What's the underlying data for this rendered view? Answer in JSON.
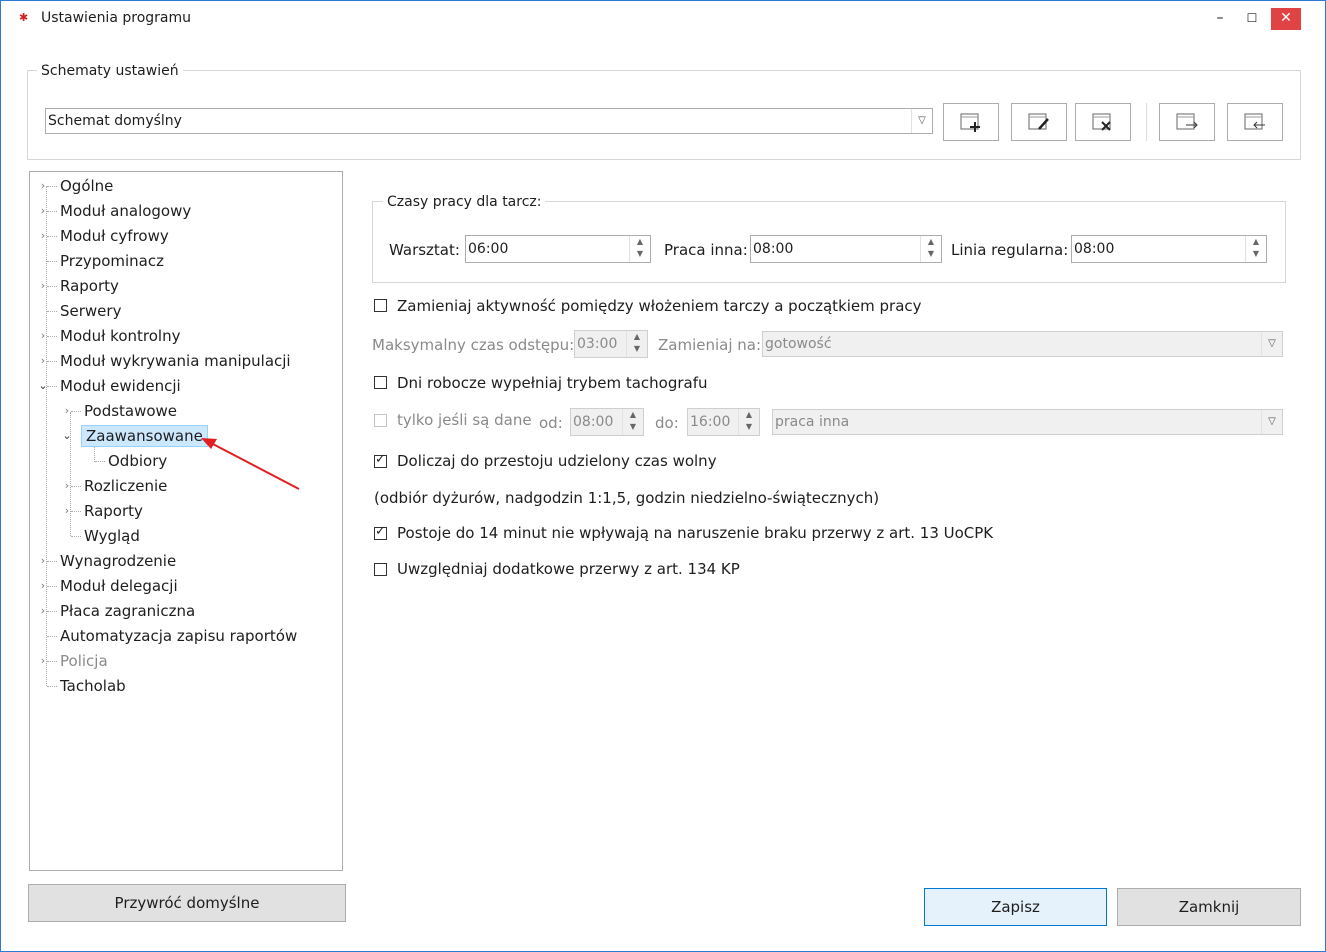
{
  "window": {
    "title": "Ustawienia programu",
    "minimize": "–",
    "maximize": "☐",
    "close": "✕"
  },
  "schemes": {
    "legend": "Schematy ustawień",
    "selected": "Schemat domyślny",
    "toolbar_icons": [
      "add-scheme-icon",
      "edit-scheme-icon",
      "delete-scheme-icon",
      "export-scheme-icon",
      "import-scheme-icon"
    ]
  },
  "tree": {
    "items": [
      {
        "label": "Ogólne"
      },
      {
        "label": "Moduł analogowy"
      },
      {
        "label": "Moduł cyfrowy"
      },
      {
        "label": "Przypominacz"
      },
      {
        "label": "Raporty"
      },
      {
        "label": "Serwery"
      },
      {
        "label": "Moduł kontrolny"
      },
      {
        "label": "Moduł wykrywania manipulacji"
      },
      {
        "label": "Moduł ewidencji"
      },
      {
        "label": "Podstawowe"
      },
      {
        "label": "Zaawansowane"
      },
      {
        "label": "Odbiory"
      },
      {
        "label": "Rozliczenie"
      },
      {
        "label": "Raporty"
      },
      {
        "label": "Wygląd"
      },
      {
        "label": "Wynagrodzenie"
      },
      {
        "label": "Moduł delegacji"
      },
      {
        "label": "Płaca zagraniczna"
      },
      {
        "label": "Automatyzacja zapisu raportów"
      },
      {
        "label": "Policja"
      },
      {
        "label": "Tacholab"
      }
    ],
    "selected": "Zaawansowane"
  },
  "work_times": {
    "legend": "Czasy pracy dla tarcz:",
    "warsztat_label": "Warsztat:",
    "warsztat_value": "06:00",
    "praca_inna_label": "Praca inna:",
    "praca_inna_value": "08:00",
    "linia_label": "Linia regularna:",
    "linia_value": "08:00"
  },
  "options": {
    "replace_activity": {
      "label": "Zamieniaj aktywność pomiędzy włożeniem tarczy a początkiem pracy",
      "checked": false
    },
    "max_gap_label": "Maksymalny czas odstępu:",
    "max_gap_value": "03:00",
    "replace_with_label": "Zamieniaj na:",
    "replace_with_value": "gotowość",
    "workdays": {
      "label": "Dni robocze wypełniaj trybem tachografu",
      "checked": false
    },
    "only_if_data": {
      "label": "tylko jeśli są dane",
      "checked": false
    },
    "from_label": "od:",
    "from_value": "08:00",
    "to_label": "do:",
    "to_value": "16:00",
    "mode_value": "praca inna",
    "add_free_time": {
      "label": "Doliczaj do przestoju udzielony czas wolny",
      "checked": true
    },
    "note": "(odbiór dyżurów, nadgodzin 1:1,5, godzin niedzielno-świątecznych)",
    "stops_14": {
      "label": "Postoje do 14 minut nie wpływają na naruszenie braku przerwy z art. 13 UoCPK",
      "checked": true
    },
    "extra_breaks": {
      "label": "Uwzględniaj dodatkowe przerwy z art. 134 KP",
      "checked": false
    }
  },
  "buttons": {
    "restore": "Przywróć domyślne",
    "save": "Zapisz",
    "close": "Zamknij"
  },
  "colors": {
    "selection": "#cce8ff",
    "close_button": "#e04343",
    "annotation_arrow": "#e02020"
  }
}
